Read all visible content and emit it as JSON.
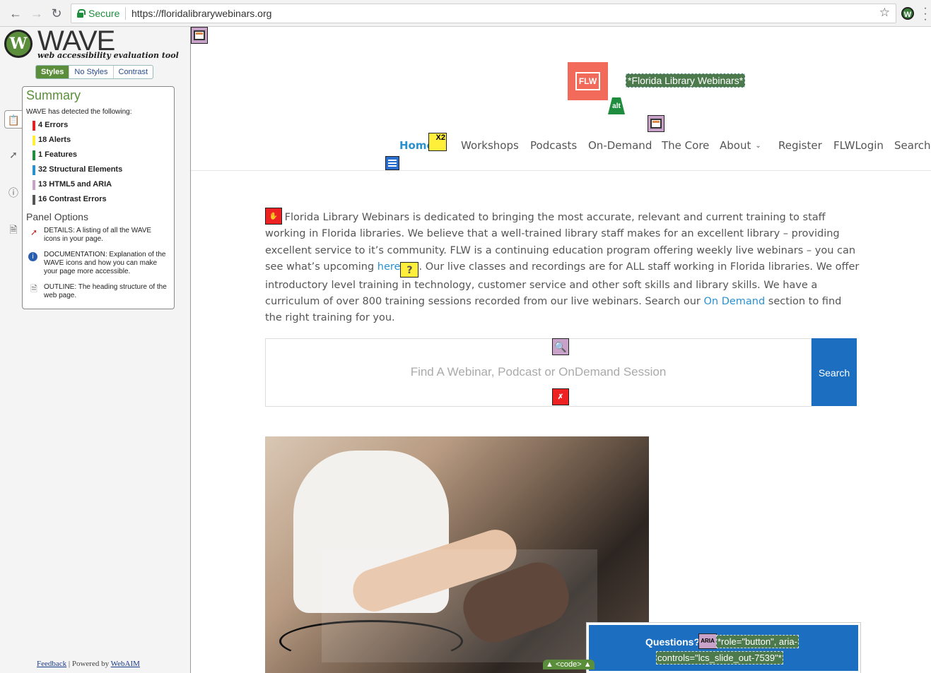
{
  "browser": {
    "secure_label": "Secure",
    "url": "https://floridalibrarywebinars.org",
    "back_icon": "arrow-left-icon",
    "forward_icon": "arrow-right-icon",
    "reload_icon": "reload-icon",
    "star_icon": "star-icon",
    "extension_icon": "wave-extension-icon",
    "menu_icon": "more-vert-icon"
  },
  "wave": {
    "logo_letter": "W",
    "title": "WAVE",
    "subtitle": "web accessibility evaluation tool",
    "style_modes": [
      "Styles",
      "No Styles",
      "Contrast"
    ],
    "selected_mode": "Styles",
    "summary_title": "Summary",
    "detected_text": "WAVE has detected the following:",
    "counts": [
      {
        "label": "4 Errors",
        "color": "#e22222"
      },
      {
        "label": "18 Alerts",
        "color": "#ffef3a"
      },
      {
        "label": "1 Features",
        "color": "#1e8e3e"
      },
      {
        "label": "32 Structural Elements",
        "color": "#2a91d0"
      },
      {
        "label": "13 HTML5 and ARIA",
        "color": "#c8a2c8"
      },
      {
        "label": "16 Contrast Errors",
        "color": "#555555"
      }
    ],
    "panel_options_title": "Panel Options",
    "options": [
      {
        "icon": "flag-icon",
        "text": "DETAILS: A listing of all the WAVE icons in your page."
      },
      {
        "icon": "info-icon",
        "text": "DOCUMENTATION: Explanation of the WAVE icons and how you can make your page more accessible."
      },
      {
        "icon": "document-icon",
        "text": "OUTLINE: The heading structure of the web page."
      }
    ],
    "feedback_link": "Feedback",
    "powered_by_text": "| Powered by",
    "webaim_link": "WebAIM"
  },
  "site": {
    "logo_text": "FLW",
    "site_title_label": "*Florida Library Webinars*",
    "alt_badge": "alt",
    "alert_badge": "X2",
    "nav": [
      {
        "label": "Home",
        "active": true
      },
      {
        "label": "Workshops"
      },
      {
        "label": "Podcasts"
      },
      {
        "label": "On-Demand"
      },
      {
        "label": "The Core"
      },
      {
        "label": "About",
        "has_dropdown": true
      },
      {
        "label": "Register"
      },
      {
        "label": "FLWLogin"
      },
      {
        "label": "Search"
      }
    ],
    "intro_1": "Florida Library Webinars is dedicated to bringing the most accurate, relevant and current training to staff working in Florida libraries. We believe that a well-trained library staff makes for an excellent library – providing excellent service to it’s community.  FLW is a continuing education program offering weekly live webinars – you can see what’s upcoming ",
    "intro_link": "here",
    "intro_2": ".  Our live classes and recordings are for ALL staff working in Florida libraries. We offer introductory level training in technology, customer service and other soft skills and library skills.  We have a curriculum of over 800 training sessions recorded from our live webinars.  Search our ",
    "intro_link2": "On Demand",
    "intro_3": " section to find the right training for you.",
    "search_placeholder": "Find A Webinar, Podcast or OnDemand Session",
    "search_button": "Search",
    "questions_label": "Questions?",
    "aria_badge": "ARIA",
    "aria_code_1": "*role=\"button\", aria-",
    "aria_code_2": "controls=\"lcs_slide_out-7539\"*",
    "code_tab": "▲ <code> ▲"
  }
}
